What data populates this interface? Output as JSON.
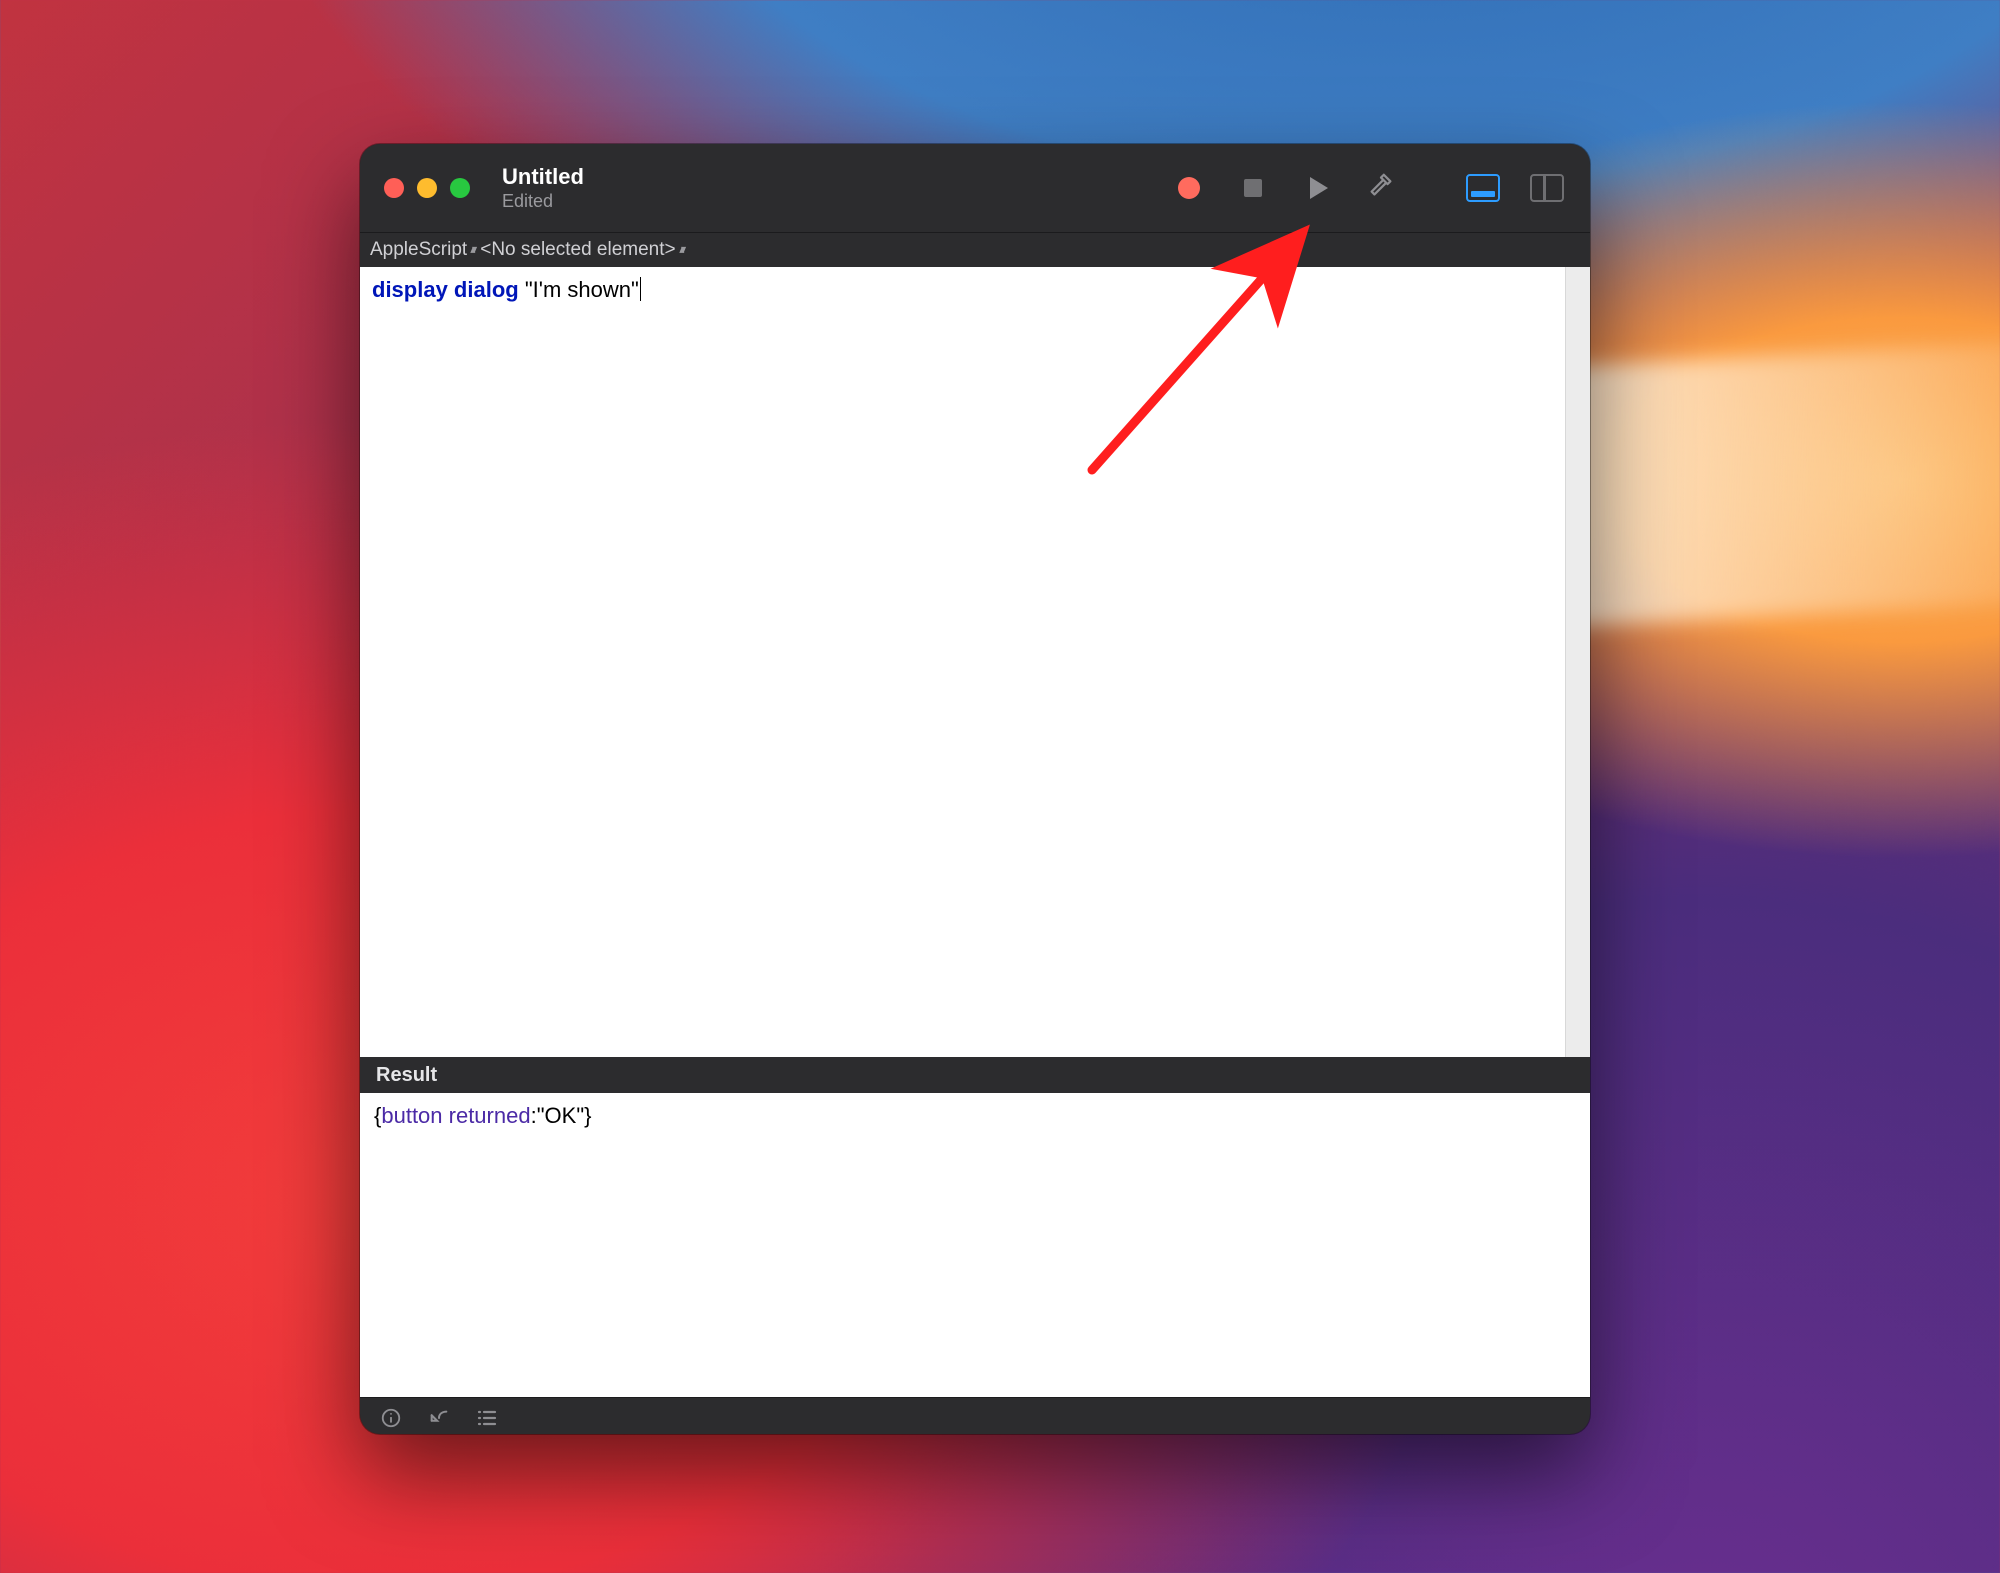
{
  "window": {
    "title": "Untitled",
    "subtitle": "Edited"
  },
  "toolbar": {
    "record_icon": "record-icon",
    "stop_icon": "stop-icon",
    "run_icon": "play-icon",
    "build_icon": "hammer-icon",
    "bottom_panel_icon": "bottom-panel-toggle-icon",
    "sidebar_icon": "right-sidebar-toggle-icon"
  },
  "navbar": {
    "language": "AppleScript",
    "element": "<No selected element>"
  },
  "editor": {
    "keyword": "display dialog",
    "string": "\"I'm shown\""
  },
  "result": {
    "header": "Result",
    "open": "{",
    "key": "button returned",
    "sep": ":",
    "value": "\"OK\"",
    "close": "}"
  },
  "annotation": {
    "target": "run-button"
  }
}
